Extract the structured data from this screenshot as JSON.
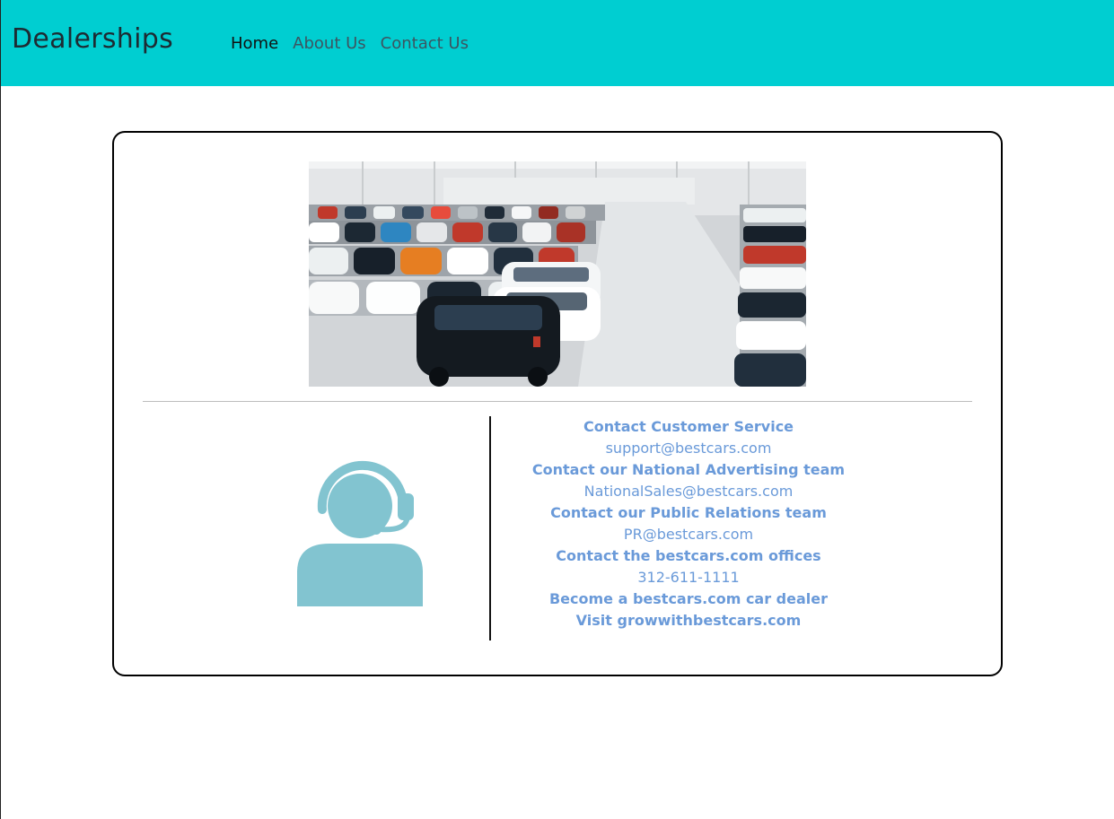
{
  "nav": {
    "brand": "Dealerships",
    "links": [
      "Home",
      "About Us",
      "Contact Us"
    ]
  },
  "contact": {
    "customer_service_label": "Contact Customer Service",
    "customer_service_email": "support@bestcars.com",
    "advertising_label": "Contact our National Advertising team",
    "advertising_email": "NationalSales@bestcars.com",
    "pr_label": "Contact our Public Relations team",
    "pr_email": "PR@bestcars.com",
    "offices_label": "Contact the bestcars.com offices",
    "offices_phone": "312-611-1111",
    "dealer_label": "Become a bestcars.com car dealer",
    "dealer_link": "Visit growwithbestcars.com"
  },
  "colors": {
    "navbar": "#00ced1",
    "accent_text": "#6a9ad9",
    "support_icon": "#82c4d0"
  }
}
